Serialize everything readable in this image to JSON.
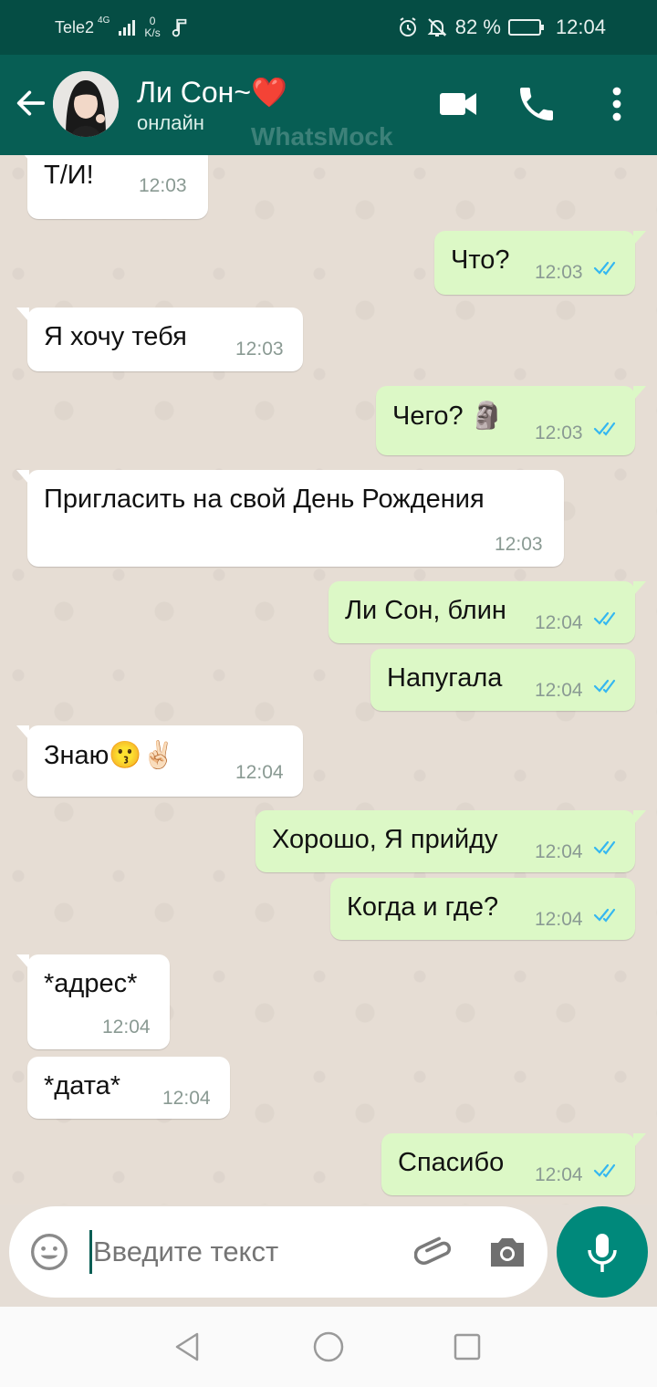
{
  "status_bar": {
    "carrier": "Tele2",
    "network_type": "4G",
    "data_speed_value": "0",
    "data_speed_unit": "K/s",
    "battery": "82 %",
    "battery_level": 0.82,
    "time": "12:04"
  },
  "header": {
    "contact_name": "Ли Сон~❤️",
    "contact_status": "онлайн",
    "watermark": "WhatsMock"
  },
  "messages": [
    {
      "direction": "in",
      "text": "Т/И!",
      "time": "12:03"
    },
    {
      "direction": "out",
      "text": "Что?",
      "time": "12:03",
      "read": true
    },
    {
      "direction": "in",
      "text": "Я хочу тебя",
      "time": "12:03"
    },
    {
      "direction": "out",
      "text": "Чего? 🗿",
      "time": "12:03",
      "read": true
    },
    {
      "direction": "in",
      "text": "Пригласить на свой День Рождения",
      "time": "12:03"
    },
    {
      "direction": "out",
      "text": "Ли Сон, блин",
      "time": "12:04",
      "read": true
    },
    {
      "direction": "out",
      "text": "Напугала",
      "time": "12:04",
      "read": true
    },
    {
      "direction": "in",
      "text": "Знаю😗✌🏻",
      "time": "12:04"
    },
    {
      "direction": "out",
      "text": "Хорошо, Я прийду",
      "time": "12:04",
      "read": true
    },
    {
      "direction": "out",
      "text": "Когда и где?",
      "time": "12:04",
      "read": true
    },
    {
      "direction": "in",
      "text": "*адрес*",
      "time": "12:04"
    },
    {
      "direction": "in",
      "text": "*дата*",
      "time": "12:04"
    },
    {
      "direction": "out",
      "text": "Спасибо",
      "time": "12:04",
      "read": true
    }
  ],
  "input": {
    "placeholder": "Введите текст"
  },
  "colors": {
    "header": "#075e54",
    "statusbar": "#054d44",
    "outgoing_bubble": "#dcf8c6",
    "incoming_bubble": "#ffffff",
    "read_ticks": "#34b7f1",
    "mic_button": "#00897b"
  },
  "icons": {
    "back": "arrow-left-icon",
    "video": "video-camera-icon",
    "call": "phone-icon",
    "menu": "more-vertical-icon",
    "emoji": "smiley-icon",
    "attach": "paperclip-icon",
    "camera": "camera-icon",
    "mic": "microphone-icon",
    "nav_back": "triangle-back-icon",
    "nav_home": "circle-home-icon",
    "nav_recent": "square-recent-icon"
  }
}
